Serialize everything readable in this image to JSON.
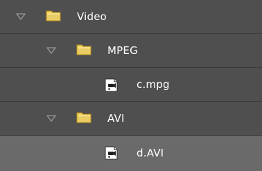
{
  "tree": {
    "items": [
      {
        "label": "Video",
        "icon": "folder-icon",
        "expanded": true
      },
      {
        "label": "MPEG",
        "icon": "folder-icon",
        "expanded": true
      },
      {
        "label": "c.mpg",
        "icon": "video-file-icon"
      },
      {
        "label": "AVI",
        "icon": "folder-icon",
        "expanded": true
      },
      {
        "label": "d.AVI",
        "icon": "video-file-icon",
        "selected": true
      }
    ]
  }
}
